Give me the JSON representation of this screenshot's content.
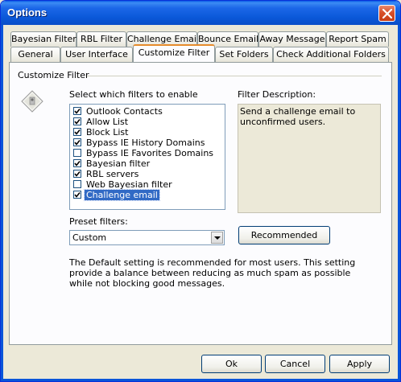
{
  "window": {
    "title": "Options"
  },
  "tabs_row1": [
    {
      "label": "Bayesian Filter"
    },
    {
      "label": "RBL Filter"
    },
    {
      "label": "Challenge Email"
    },
    {
      "label": "Bounce Email"
    },
    {
      "label": "Away Message"
    },
    {
      "label": "Report Spam"
    }
  ],
  "tabs_row2": [
    {
      "label": "General"
    },
    {
      "label": "User Interface"
    },
    {
      "label": "Customize Filter",
      "active": true
    },
    {
      "label": "Set Folders"
    },
    {
      "label": "Check Additional Folders"
    }
  ],
  "customize": {
    "group_label": "Customize Filter",
    "filters_heading": "Select which filters to enable",
    "filters": [
      {
        "label": "Outlook Contacts",
        "checked": true
      },
      {
        "label": "Allow List",
        "checked": true
      },
      {
        "label": "Block List",
        "checked": true
      },
      {
        "label": "Bypass IE History Domains",
        "checked": true
      },
      {
        "label": "Bypass IE Favorites Domains",
        "checked": false
      },
      {
        "label": "Bayesian filter",
        "checked": true
      },
      {
        "label": "RBL servers",
        "checked": true
      },
      {
        "label": "Web Bayesian filter",
        "checked": false
      },
      {
        "label": "Challenge email",
        "checked": true,
        "selected": true
      }
    ],
    "description_heading": "Filter Description:",
    "description": "Send a challenge email to unconfirmed users.",
    "preset_label": "Preset filters:",
    "preset_value": "Custom",
    "recommended_label": "Recommended",
    "note": "The Default setting is recommended for most users. This setting provide a balance between reducing as much spam as possible while not blocking good messages."
  },
  "buttons": {
    "ok": "Ok",
    "cancel": "Cancel",
    "apply": "Apply"
  },
  "colors": {
    "titlebar": "#0a58d8",
    "selection": "#316ac5",
    "active_tab_accent": "#e68b2c"
  }
}
